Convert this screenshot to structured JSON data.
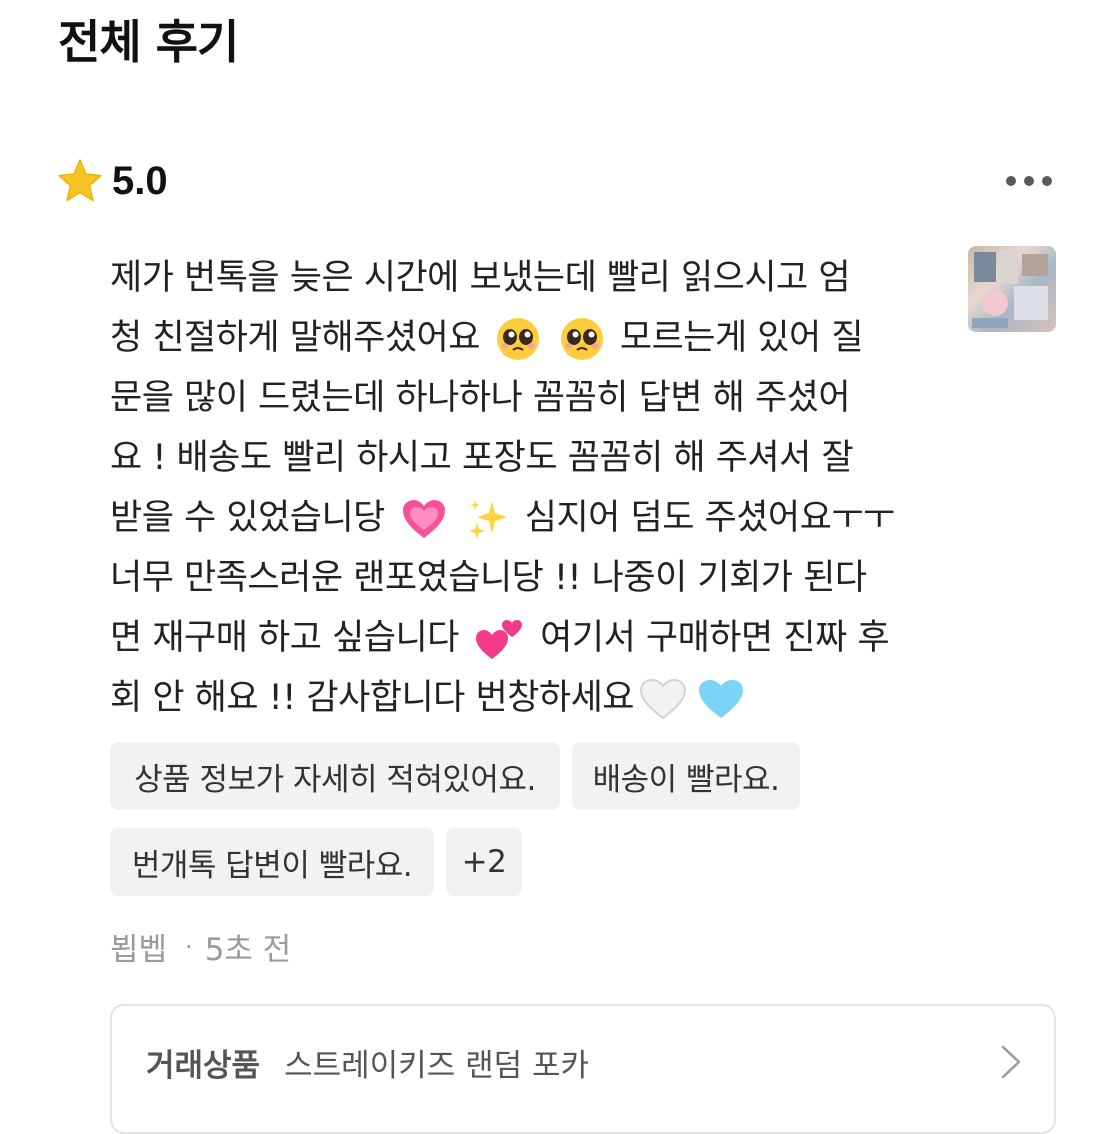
{
  "page": {
    "title": "전체 후기"
  },
  "review": {
    "rating": "5.0",
    "lines": [
      "제가 번톡을 늦은 시간에 보냈는데 빨리 읽으시고 엄",
      "청 친절하게 말해주셨어요",
      "모르는게 있어 질",
      "문을 많이 드렸는데 하나하나 꼼꼼히 답변 해 주셨어",
      "요 ! 배송도 빨리 하시고 포장도 꼼꼼히 해 주셔서 잘",
      "받을 수 있었습니당",
      "심지어 덤도 주셨어요ㅜㅜ",
      "너무 만족스러운 랜포였습니당 !! 나중이 기회가 된다",
      "면 재구매 하고 싶습니다",
      "여기서 구매하면 진짜 후",
      "회 안 해요 !! 감사합니다 번창하세요"
    ],
    "tags": [
      "상품 정보가 자세히 적혀있어요.",
      "배송이 빨라요.",
      "번개톡 답변이 빨라요.",
      "+2"
    ],
    "author": "뵙벱",
    "time": "5초 전"
  },
  "product": {
    "label": "거래상품",
    "name": "스트레이키즈 랜덤 포카"
  },
  "icons": {
    "star": "star-icon",
    "more": "more-dots-icon",
    "pleading": "pleading-face-emoji",
    "heart_pink": "growing-heart-emoji",
    "sparkles": "sparkles-emoji",
    "two_hearts": "two-hearts-emoji",
    "white_heart": "white-heart-emoji",
    "blue_heart": "light-blue-heart-emoji",
    "chevron": "chevron-right-icon"
  },
  "colors": {
    "star": "#F7C325",
    "tag_bg": "#F2F2F2",
    "muted": "#9A9A9A",
    "border": "#E4E4E4"
  }
}
